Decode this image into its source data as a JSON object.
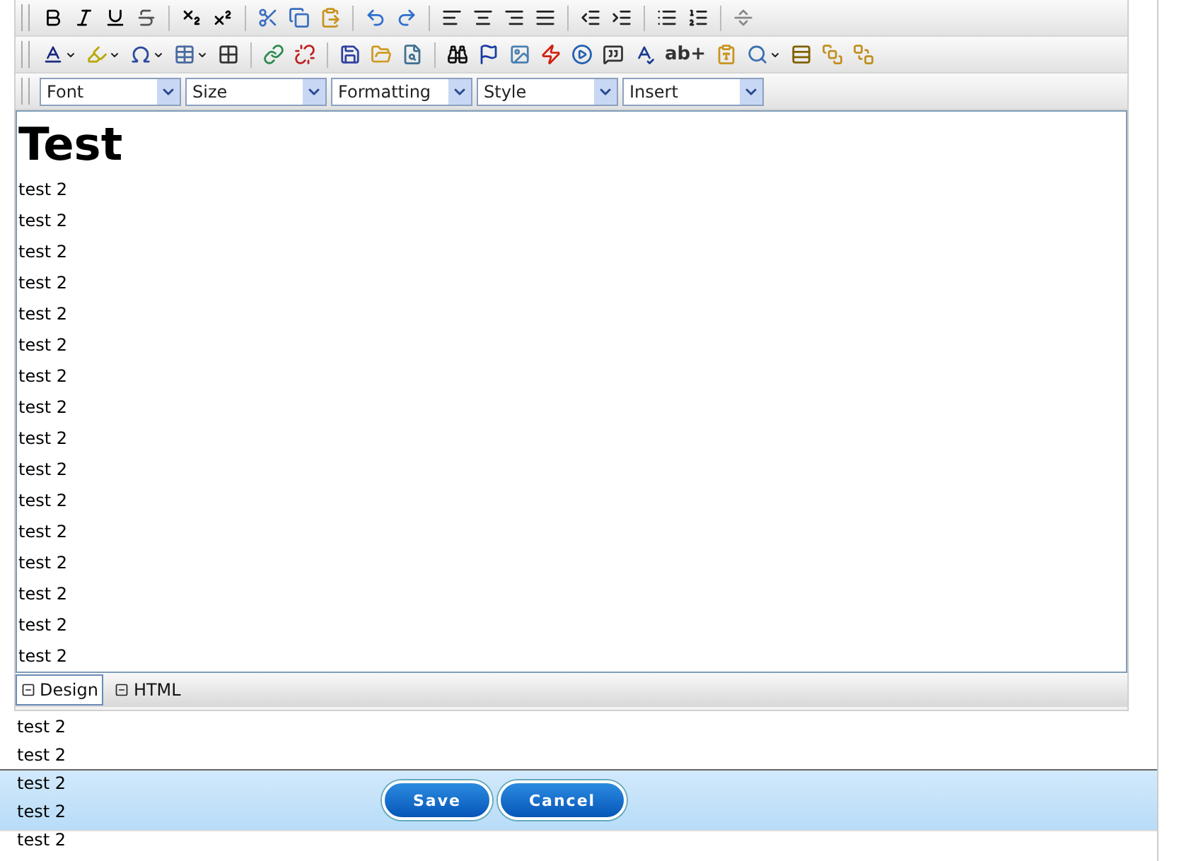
{
  "selects": [
    {
      "label": "Font"
    },
    {
      "label": "Size"
    },
    {
      "label": "Formatting"
    },
    {
      "label": "Style"
    },
    {
      "label": "Insert"
    }
  ],
  "toolbar_text_button": "ab+",
  "heading": "Test",
  "lines": [
    "test 2",
    "test 2",
    "test 2",
    "test 2",
    "test 2",
    "test 2",
    "test 2",
    "test 2",
    "test 2",
    "test 2",
    "test 2",
    "test 2",
    "test 2",
    "test 2",
    "test 2",
    "test 2"
  ],
  "mode_tabs": [
    {
      "label": "Design",
      "selected": true
    },
    {
      "label": "HTML",
      "selected": false
    }
  ],
  "overflow_lines": [
    "test 2",
    "test 2",
    "test 2",
    "test 2",
    "test 2"
  ],
  "buttons": [
    "Save",
    "Cancel"
  ]
}
